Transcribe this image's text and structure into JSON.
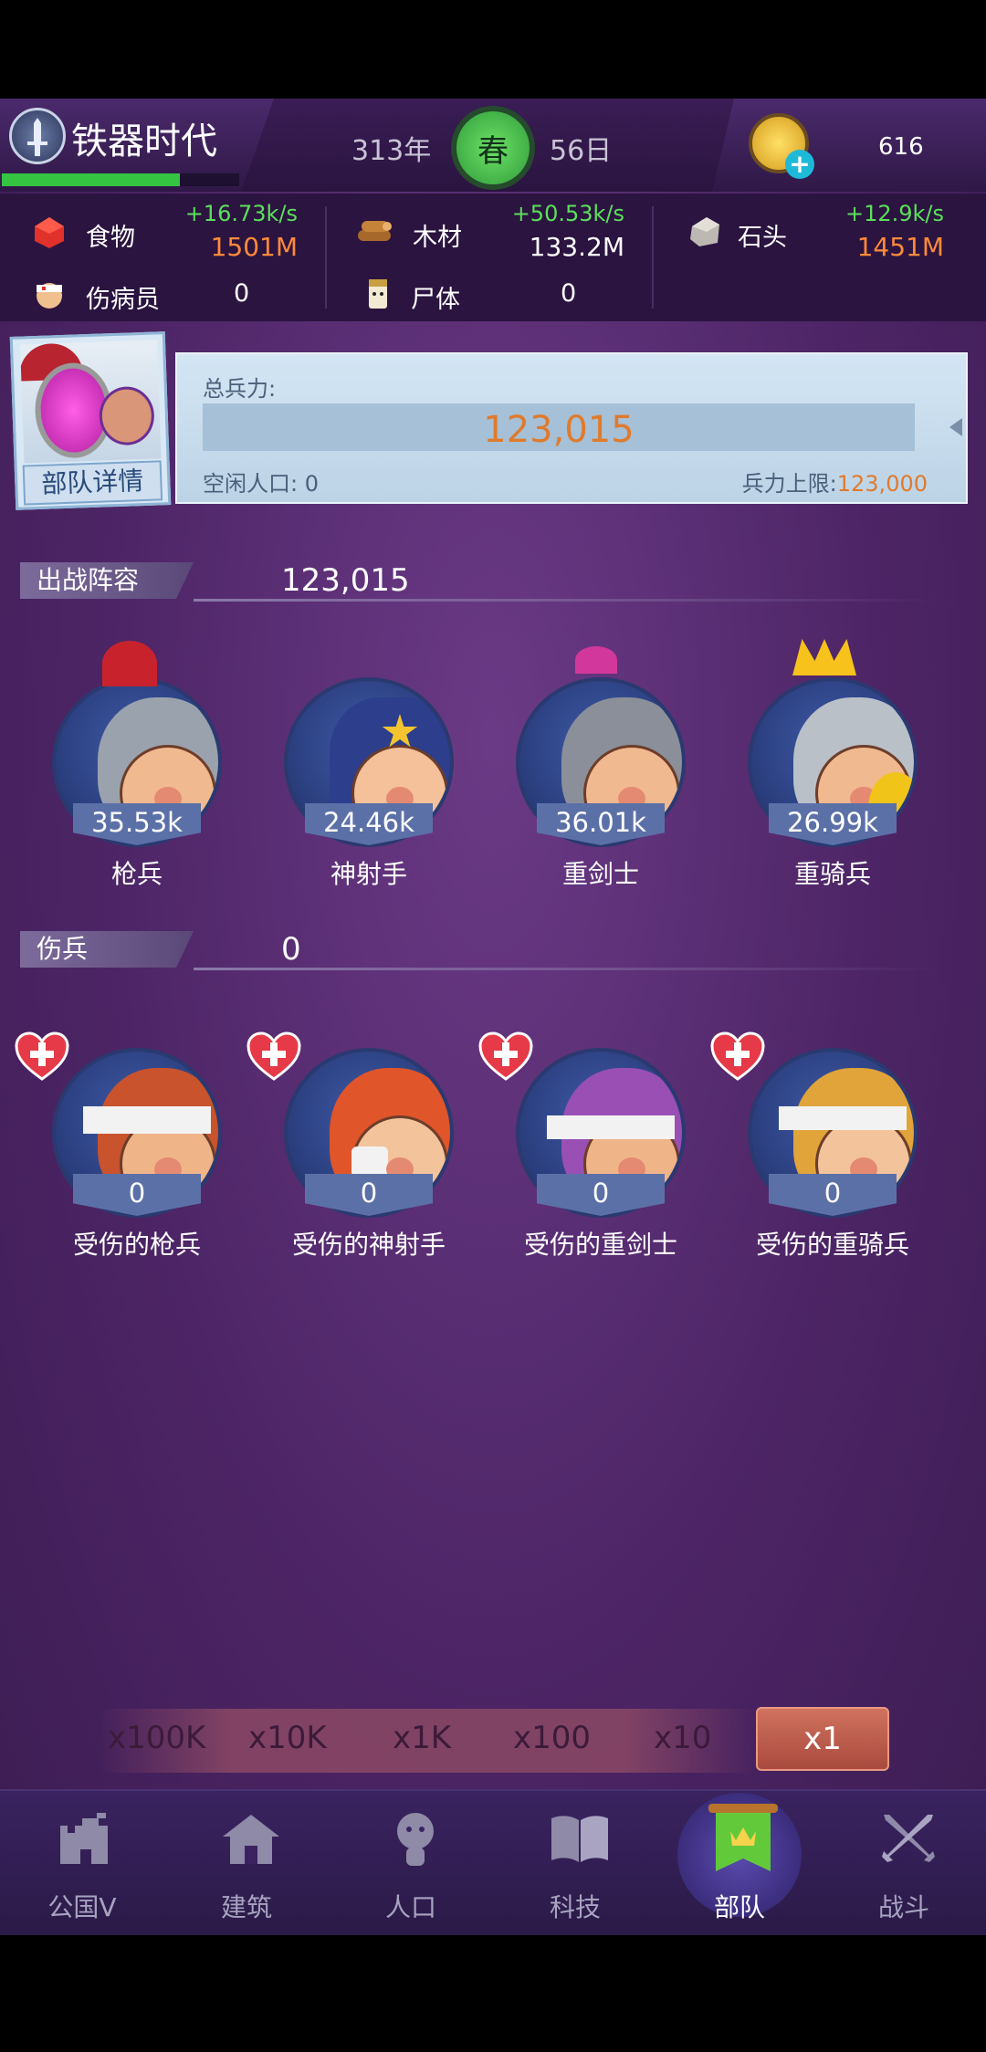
{
  "topbar": {
    "era": "铁器时代",
    "year": "313年",
    "season": "春",
    "day": "56日",
    "gold": "616",
    "era_progress": 0.75
  },
  "resources": {
    "food": {
      "label": "食物",
      "rate": "+16.73k/s",
      "amount": "1501M"
    },
    "wood": {
      "label": "木材",
      "rate": "+50.53k/s",
      "amount": "133.2M"
    },
    "stone": {
      "label": "石头",
      "rate": "+12.9k/s",
      "amount": "1451M"
    },
    "wounded": {
      "label": "伤病员",
      "count": "0"
    },
    "corpse": {
      "label": "尸体",
      "count": "0"
    }
  },
  "summary": {
    "portrait_button": "部队详情",
    "total_label": "总兵力:",
    "total_value": "123,015",
    "idle_label": "空闲人口:",
    "idle_value": "0",
    "cap_label": "兵力上限:",
    "cap_value": "123,000"
  },
  "lineup": {
    "title": "出战阵容",
    "value": "123,015",
    "units": [
      {
        "count": "35.53k",
        "name": "枪兵"
      },
      {
        "count": "24.46k",
        "name": "神射手"
      },
      {
        "count": "36.01k",
        "name": "重剑士"
      },
      {
        "count": "26.99k",
        "name": "重骑兵"
      }
    ]
  },
  "wounded_section": {
    "title": "伤兵",
    "value": "0",
    "units": [
      {
        "count": "0",
        "name": "受伤的枪兵"
      },
      {
        "count": "0",
        "name": "受伤的神射手"
      },
      {
        "count": "0",
        "name": "受伤的重剑士"
      },
      {
        "count": "0",
        "name": "受伤的重骑兵"
      }
    ]
  },
  "multipliers": [
    "x100K",
    "x10K",
    "x1K",
    "x100",
    "x10",
    "x1"
  ],
  "nav": [
    {
      "label": "公国V",
      "icon": "castle-icon"
    },
    {
      "label": "建筑",
      "icon": "house-icon"
    },
    {
      "label": "人口",
      "icon": "person-icon"
    },
    {
      "label": "科技",
      "icon": "book-icon"
    },
    {
      "label": "部队",
      "icon": "banner-icon"
    },
    {
      "label": "战斗",
      "icon": "crossed-swords-icon"
    }
  ],
  "colors": {
    "accent_orange": "#e07a2c",
    "rate_green": "#5be05a",
    "bg_purple": "#4d2566"
  }
}
